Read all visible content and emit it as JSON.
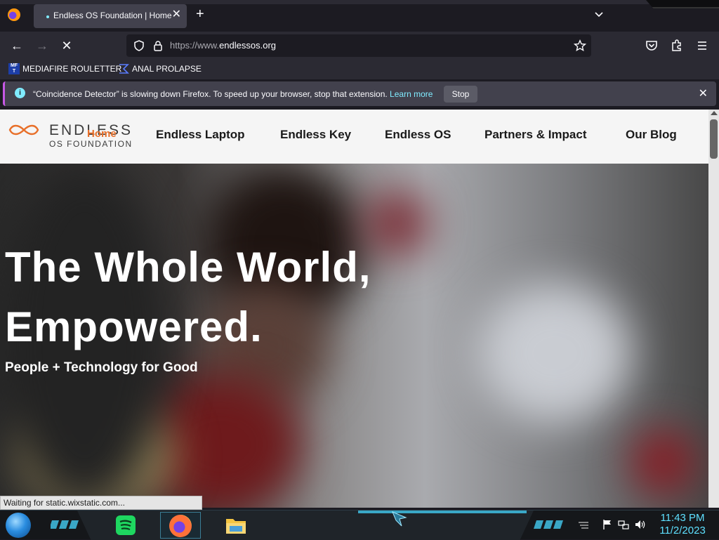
{
  "browser": {
    "tab": {
      "title": "Endless OS Foundation | Home"
    },
    "url": {
      "prefix": "https://www.",
      "domain": "endlessos.org"
    }
  },
  "bookmarks": [
    {
      "icon": "mediafire-icon",
      "label": "MEDIAFIRE ROULETTER"
    },
    {
      "icon": "sigma-icon",
      "label": "ANAL PROLAPSE"
    }
  ],
  "notification": {
    "message": "“Coincidence Detector” is slowing down Firefox. To speed up your browser, stop that extension.",
    "link": "Learn more",
    "button": "Stop"
  },
  "site": {
    "logo": {
      "line1": "ENDLESS",
      "line2": "OS FOUNDATION",
      "hover_label": "Home"
    },
    "nav": [
      "Endless Laptop",
      "Endless Key",
      "Endless OS",
      "Partners & Impact",
      "Our Blog"
    ],
    "hero": {
      "headline_1": "The Whole World,",
      "headline_2": "Empowered.",
      "tagline": "People + Technology for Good"
    }
  },
  "status_text": "Waiting for static.wixstatic.com...",
  "taskbar": {
    "time": "11:43 PM",
    "date": "11/2/2023"
  },
  "colors": {
    "accent_cyan": "#80ebff",
    "logo_orange": "#e8702a",
    "clock_cyan": "#5ee0ff"
  }
}
